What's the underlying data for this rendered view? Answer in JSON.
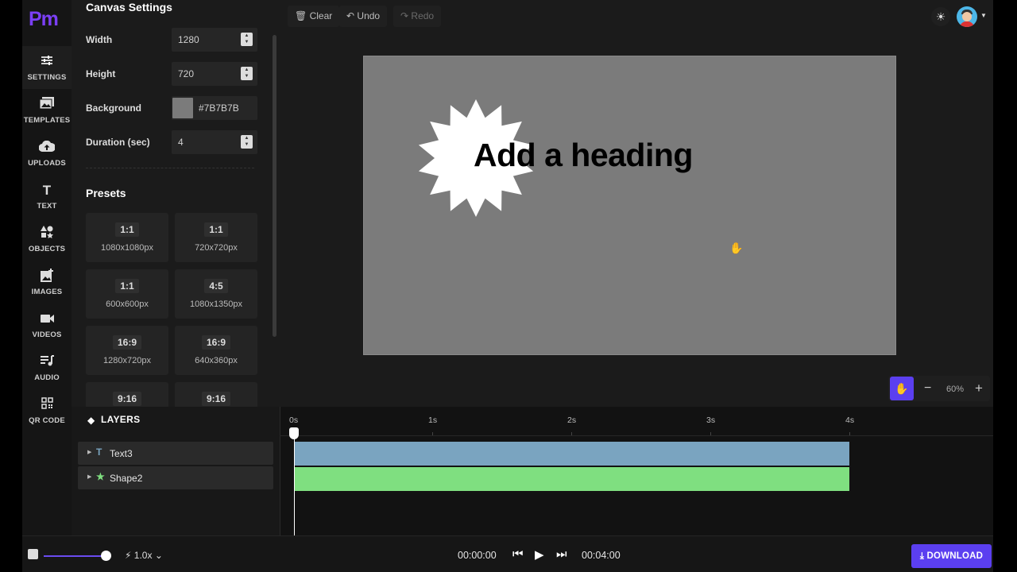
{
  "app": {
    "logo": "Pm"
  },
  "rail": [
    {
      "icon": "sliders-icon",
      "glyph": "☰",
      "label": "SETTINGS",
      "active": true
    },
    {
      "icon": "templates-icon",
      "glyph": "▣",
      "label": "TEMPLATES"
    },
    {
      "icon": "cloud-upload-icon",
      "glyph": "☁",
      "label": "UPLOADS"
    },
    {
      "icon": "text-icon",
      "glyph": "T",
      "label": "TEXT"
    },
    {
      "icon": "shapes-icon",
      "glyph": "◆",
      "label": "OBJECTS"
    },
    {
      "icon": "image-add-icon",
      "glyph": "▧",
      "label": "IMAGES"
    },
    {
      "icon": "video-camera-icon",
      "glyph": "■",
      "label": "VIDEOS"
    },
    {
      "icon": "audio-icon",
      "glyph": "♫",
      "label": "AUDIO"
    },
    {
      "icon": "qr-code-icon",
      "glyph": "▦",
      "label": "QR CODE"
    }
  ],
  "settings": {
    "title": "Canvas Settings",
    "width_label": "Width",
    "width_value": "1280",
    "height_label": "Height",
    "height_value": "720",
    "background_label": "Background",
    "background_value": "#7B7B7B",
    "duration_label": "Duration (sec)",
    "duration_value": "4",
    "presets_title": "Presets",
    "presets": [
      {
        "ratio": "1:1",
        "size": "1080x1080px"
      },
      {
        "ratio": "1:1",
        "size": "720x720px"
      },
      {
        "ratio": "1:1",
        "size": "600x600px"
      },
      {
        "ratio": "4:5",
        "size": "1080x1350px"
      },
      {
        "ratio": "16:9",
        "size": "1280x720px"
      },
      {
        "ratio": "16:9",
        "size": "640x360px"
      },
      {
        "ratio": "9:16",
        "size": ""
      },
      {
        "ratio": "9:16",
        "size": ""
      }
    ]
  },
  "toolbar": {
    "clear": "Clear",
    "undo": "Undo",
    "redo": "Redo"
  },
  "canvas": {
    "background": "#7b7b7b",
    "heading": "Add a heading",
    "star_color": "#ffffff"
  },
  "zoom": {
    "value": "60%",
    "minus": "−",
    "plus": "+"
  },
  "layers": {
    "title": "LAYERS",
    "items": [
      {
        "name": "Text3",
        "icon": "T",
        "color": "#7aa4c0"
      },
      {
        "name": "Shape2",
        "icon": "★",
        "color": "#7fdf80"
      }
    ]
  },
  "timeline": {
    "ticks": [
      "0s",
      "1s",
      "2s",
      "3s",
      "4s"
    ]
  },
  "player": {
    "current": "00:00:00",
    "total": "00:04:00",
    "speed": "1.0x",
    "download": "DOWNLOAD"
  },
  "colors": {
    "accent": "#5b3ff0",
    "text_track": "#7aa4c0",
    "shape_track": "#7fdf80"
  }
}
